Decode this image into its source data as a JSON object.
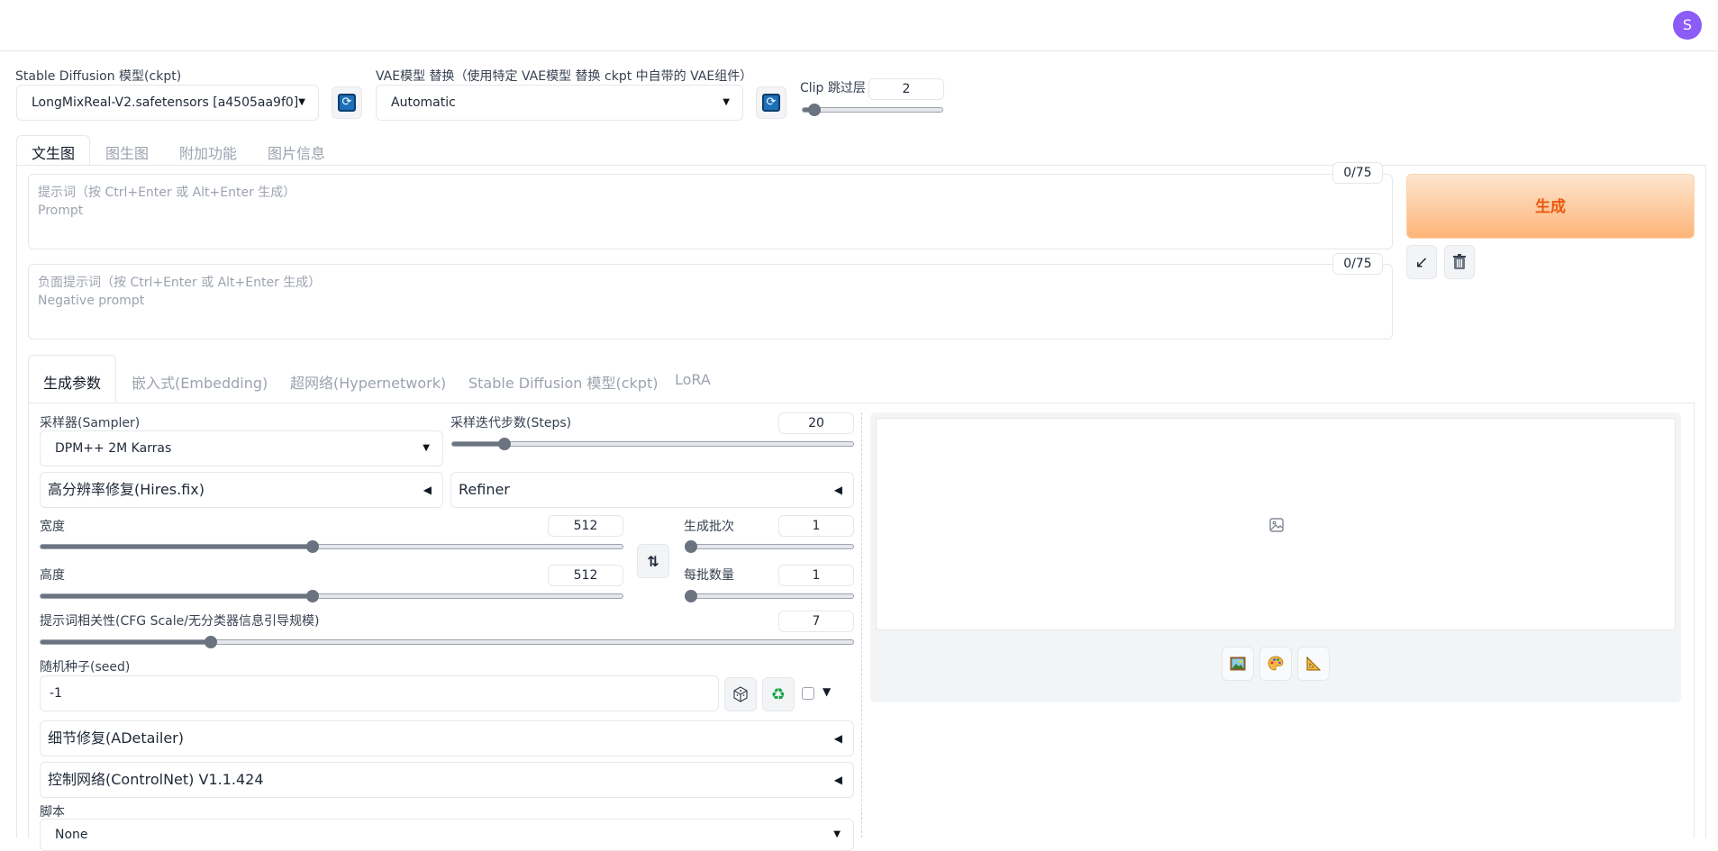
{
  "header": {
    "avatar_letter": "S"
  },
  "model": {
    "ckpt_label": "Stable Diffusion 模型(ckpt)",
    "ckpt_value": "LongMixReal-V2.safetensors [a4505aa9f0]",
    "vae_label": "VAE模型 替换（使用特定 VAE模型 替换 ckpt 中自带的 VAE组件）",
    "vae_value": "Automatic",
    "clip_label": "Clip 跳过层",
    "clip_value": "2",
    "clip_fraction": 0.083
  },
  "main_tabs": [
    "文生图",
    "图生图",
    "附加功能",
    "图片信息"
  ],
  "prompt": {
    "placeholder": "提示词（按 Ctrl+Enter 或 Alt+Enter 生成）\nPrompt",
    "counter": "0/75"
  },
  "negative": {
    "placeholder": "负面提示词（按 Ctrl+Enter 或 Alt+Enter 生成）\nNegative prompt",
    "counter": "0/75"
  },
  "generate_label": "生成",
  "sub_tabs": [
    "生成参数",
    "嵌入式(Embedding)",
    "超网络(Hypernetwork)",
    "Stable Diffusion 模型(ckpt)",
    "LoRA"
  ],
  "params": {
    "sampler_label": "采样器(Sampler)",
    "sampler_value": "DPM++ 2M Karras",
    "steps_label": "采样迭代步数(Steps)",
    "steps_value": "20",
    "steps_fraction": 0.13,
    "hires_label": "高分辨率修复(Hires.fix)",
    "refiner_label": "Refiner",
    "width_label": "宽度",
    "width_value": "512",
    "width_fraction": 0.467,
    "height_label": "高度",
    "height_value": "512",
    "height_fraction": 0.467,
    "batch_count_label": "生成批次",
    "batch_count_value": "1",
    "batch_count_fraction": 0.0,
    "batch_size_label": "每批数量",
    "batch_size_value": "1",
    "batch_size_fraction": 0.0,
    "cfg_label": "提示词相关性(CFG Scale/无分类器信息引导规模)",
    "cfg_value": "7",
    "cfg_fraction": 0.21,
    "seed_label": "随机种子(seed)",
    "seed_value": "-1",
    "adetailer_label": "细节修复(ADetailer)",
    "controlnet_label": "控制网络(ControlNet) V1.1.424",
    "script_label": "脚本",
    "script_value": "None"
  }
}
